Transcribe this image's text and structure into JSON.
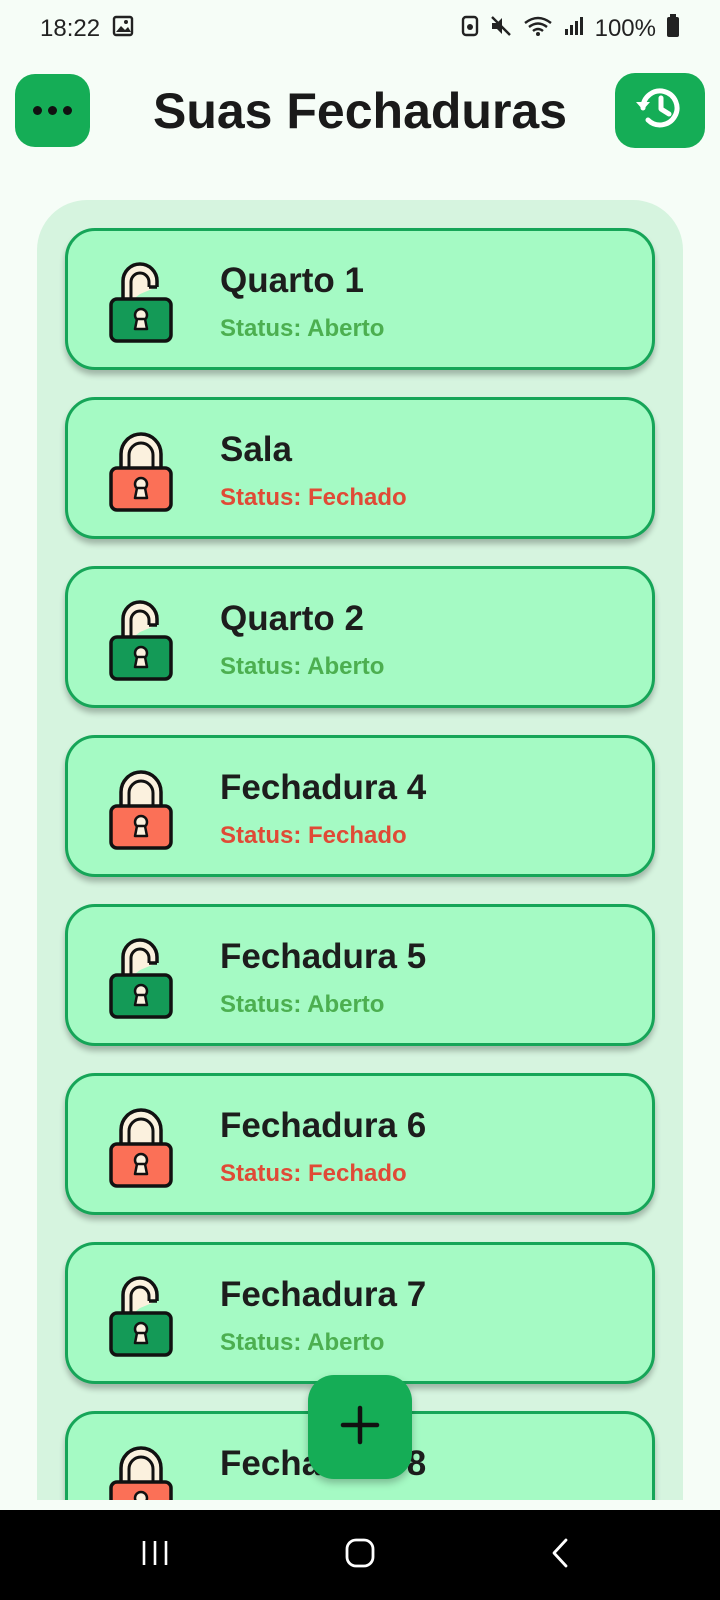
{
  "status_bar": {
    "time": "18:22",
    "battery": "100%",
    "icons": [
      "image-icon",
      "cast-icon",
      "mute-icon",
      "wifi-icon",
      "signal-icon",
      "battery-icon"
    ]
  },
  "header": {
    "title": "Suas Fechaduras",
    "menu_icon": "more-horizontal-icon",
    "history_icon": "history-icon"
  },
  "locks": [
    {
      "name": "Quarto 1",
      "status": "Status: Aberto",
      "state": "open"
    },
    {
      "name": "Sala",
      "status": "Status: Fechado",
      "state": "closed"
    },
    {
      "name": "Quarto 2",
      "status": "Status: Aberto",
      "state": "open"
    },
    {
      "name": "Fechadura 4",
      "status": "Status: Fechado",
      "state": "closed"
    },
    {
      "name": "Fechadura 5",
      "status": "Status: Aberto",
      "state": "open"
    },
    {
      "name": "Fechadura 6",
      "status": "Status: Fechado",
      "state": "closed"
    },
    {
      "name": "Fechadura 7",
      "status": "Status: Aberto",
      "state": "open"
    },
    {
      "name": "Fechadura 8",
      "status": "",
      "state": "closed"
    }
  ],
  "fab": {
    "icon": "plus-icon"
  },
  "nav_bar": {
    "icons": [
      "recents-icon",
      "home-icon",
      "back-icon"
    ]
  },
  "colors": {
    "primary": "#15ad56",
    "card": "#a5fac4",
    "card_border": "#16a558",
    "panel": "#d6f4df",
    "open_status": "#4caf50",
    "closed_status": "#e04a36",
    "open_lock": "#149a57",
    "closed_lock": "#fb7057"
  }
}
